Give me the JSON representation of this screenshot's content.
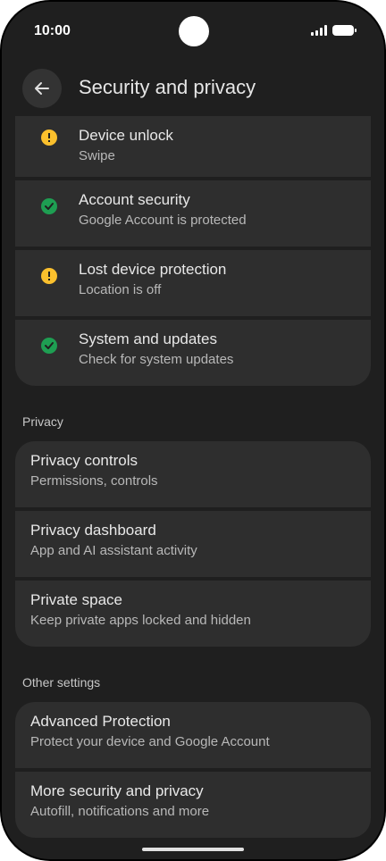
{
  "status_bar": {
    "time": "10:00"
  },
  "app_bar": {
    "title": "Security and privacy"
  },
  "security_items": [
    {
      "title": "Device unlock",
      "subtitle": "Swipe",
      "status": "warning",
      "status_icon": "exclamation-circle-icon",
      "color": "#fbc02d"
    },
    {
      "title": "Account security",
      "subtitle": "Google Account is protected",
      "status": "ok",
      "status_icon": "check-circle-icon",
      "color": "#1e9e52"
    },
    {
      "title": "Lost device protection",
      "subtitle": "Location is off",
      "status": "warning",
      "status_icon": "exclamation-circle-icon",
      "color": "#fbc02d"
    },
    {
      "title": "System and updates",
      "subtitle": "Check for system updates",
      "status": "ok",
      "status_icon": "check-circle-icon",
      "color": "#1e9e52"
    }
  ],
  "privacy": {
    "header": "Privacy",
    "items": [
      {
        "title": "Privacy controls",
        "subtitle": "Permissions, controls"
      },
      {
        "title": "Privacy dashboard",
        "subtitle": "App and AI assistant activity"
      },
      {
        "title": "Private space",
        "subtitle": "Keep private apps locked and hidden"
      }
    ]
  },
  "other": {
    "header": "Other settings",
    "items": [
      {
        "title": "Advanced Protection",
        "subtitle": "Protect your device and Google Account"
      },
      {
        "title": "More security and privacy",
        "subtitle": "Autofill, notifications and more"
      }
    ]
  },
  "colors": {
    "background": "#1f1f1f",
    "card": "#2e2e2e",
    "warning": "#fbc02d",
    "ok": "#1e9e52"
  }
}
